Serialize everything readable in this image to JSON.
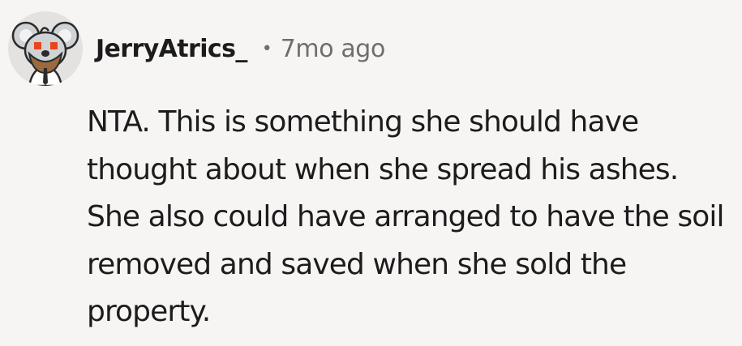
{
  "comment": {
    "author": "JerryAtrics_",
    "separator": "•",
    "timestamp": "7mo ago",
    "body": "NTA. This is something she should have thought about when she spread his ashes. She also could have arranged to have the soil removed and saved when she sold the property.",
    "avatar_icon": "koala-avatar-icon"
  },
  "colors": {
    "background": "#f7f5f4",
    "text": "#1c1c1c",
    "muted": "#6e6e6e",
    "avatar_bg": "#e4e2e1",
    "avatar_eyes": "#e8461b"
  }
}
